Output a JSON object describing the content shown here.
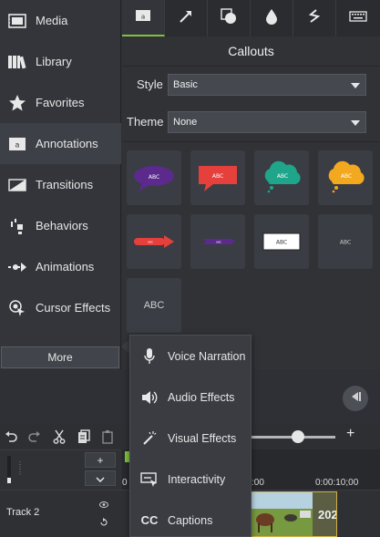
{
  "sidebar": {
    "items": [
      {
        "label": "Media",
        "icon": "film-icon"
      },
      {
        "label": "Library",
        "icon": "library-icon"
      },
      {
        "label": "Favorites",
        "icon": "star-icon"
      },
      {
        "label": "Annotations",
        "icon": "annotation-icon",
        "active": true
      },
      {
        "label": "Transitions",
        "icon": "transition-icon"
      },
      {
        "label": "Behaviors",
        "icon": "behaviors-icon"
      },
      {
        "label": "Animations",
        "icon": "animation-arrow-icon"
      },
      {
        "label": "Cursor Effects",
        "icon": "cursor-icon"
      }
    ],
    "more_label": "More"
  },
  "tabs": [
    {
      "icon": "callout-tab-icon",
      "active": true
    },
    {
      "icon": "arrow-tab-icon"
    },
    {
      "icon": "shape-tab-icon"
    },
    {
      "icon": "blur-drop-icon"
    },
    {
      "icon": "sketch-motion-icon"
    },
    {
      "icon": "keyboard-icon"
    }
  ],
  "panel": {
    "title": "Callouts",
    "style_label": "Style",
    "style_value": "Basic",
    "theme_label": "Theme",
    "theme_value": "None",
    "callouts": [
      {
        "text": "ABC",
        "shape": "speech-oval",
        "color": "#5b2a8c"
      },
      {
        "text": "ABC",
        "shape": "speech-rect",
        "color": "#e5403c"
      },
      {
        "text": "ABC",
        "shape": "thought-cloud",
        "color": "#1fa58a"
      },
      {
        "text": "ABC",
        "shape": "thought-cloud",
        "color": "#f2a81f"
      },
      {
        "text": "ABC",
        "shape": "arrow",
        "color": "#e5403c"
      },
      {
        "text": "ABC",
        "shape": "arrow-double",
        "color": "#5b2a8c"
      },
      {
        "text": "ABC",
        "shape": "white-box",
        "color": "#ffffff"
      },
      {
        "text": "ABC",
        "shape": "text",
        "color": "#d0d0d0"
      },
      {
        "text": "ABC",
        "shape": "text-large",
        "color": "#d0d0d0"
      }
    ]
  },
  "popup_menu": {
    "items": [
      {
        "label": "Voice Narration",
        "icon": "microphone-icon"
      },
      {
        "label": "Audio Effects",
        "icon": "speaker-icon"
      },
      {
        "label": "Visual Effects",
        "icon": "magic-wand-icon"
      },
      {
        "label": "Interactivity",
        "icon": "interactivity-icon"
      },
      {
        "label": "Captions",
        "icon": "cc-icon",
        "icon_text": "CC"
      }
    ]
  },
  "timeline": {
    "zoom_plus": "+",
    "add_track": "+",
    "ruler_labels": [
      ":00",
      "0:00:10;00"
    ],
    "ruler_start": "0",
    "track_name": "Track 2",
    "clip_label": "202"
  },
  "colors": {
    "accent_green": "#7fc241",
    "clip_border": "#d4b04a"
  }
}
